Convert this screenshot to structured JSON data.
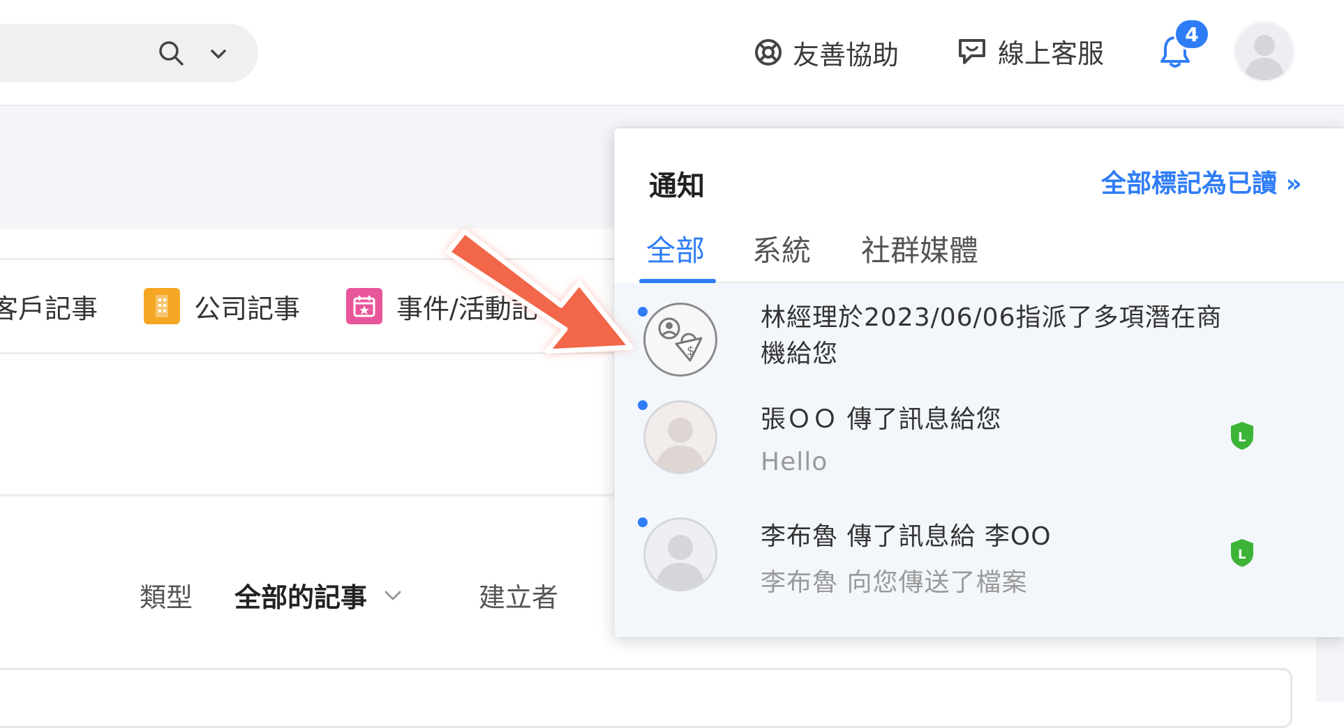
{
  "header": {
    "help_label": "友善協助",
    "support_label": "線上客服",
    "notification_count": "4"
  },
  "background": {
    "note_tabs": [
      {
        "label": "客戶記事",
        "icon": "customer-note-icon"
      },
      {
        "label": "公司記事",
        "icon": "building-icon",
        "color": "#f5a623"
      },
      {
        "label": "事件/活動記",
        "icon": "calendar-star-icon",
        "color": "#e8559a"
      }
    ],
    "filter": {
      "type_label": "類型",
      "type_value": "全部的記事",
      "creator_label": "建立者"
    }
  },
  "panel": {
    "title": "通知",
    "mark_all_read": "全部標記為已讀 »",
    "tabs": [
      "全部",
      "系統",
      "社群媒體"
    ],
    "active_tab": "全部",
    "items": [
      {
        "title_line1": "林經理於2023/06/06指派了多項潛在商",
        "title_line2": "機給您",
        "subtitle": "",
        "avatar": "opportunity-icon",
        "unread": true
      },
      {
        "title_line1": "張ＯＯ 傳了訊息給您",
        "title_line2": "",
        "subtitle": "Hello",
        "avatar": "user-avatar",
        "channel": "LINE",
        "unread": true
      },
      {
        "title_line1": "李布魯 傳了訊息給 李OO",
        "title_line2": "",
        "subtitle": "李布魯 向您傳送了檔案",
        "avatar": "user-avatar",
        "channel": "LINE",
        "unread": true
      }
    ]
  },
  "colors": {
    "accent": "#2f7df6",
    "line_green": "#3db438",
    "arrow": "#f2664a"
  }
}
